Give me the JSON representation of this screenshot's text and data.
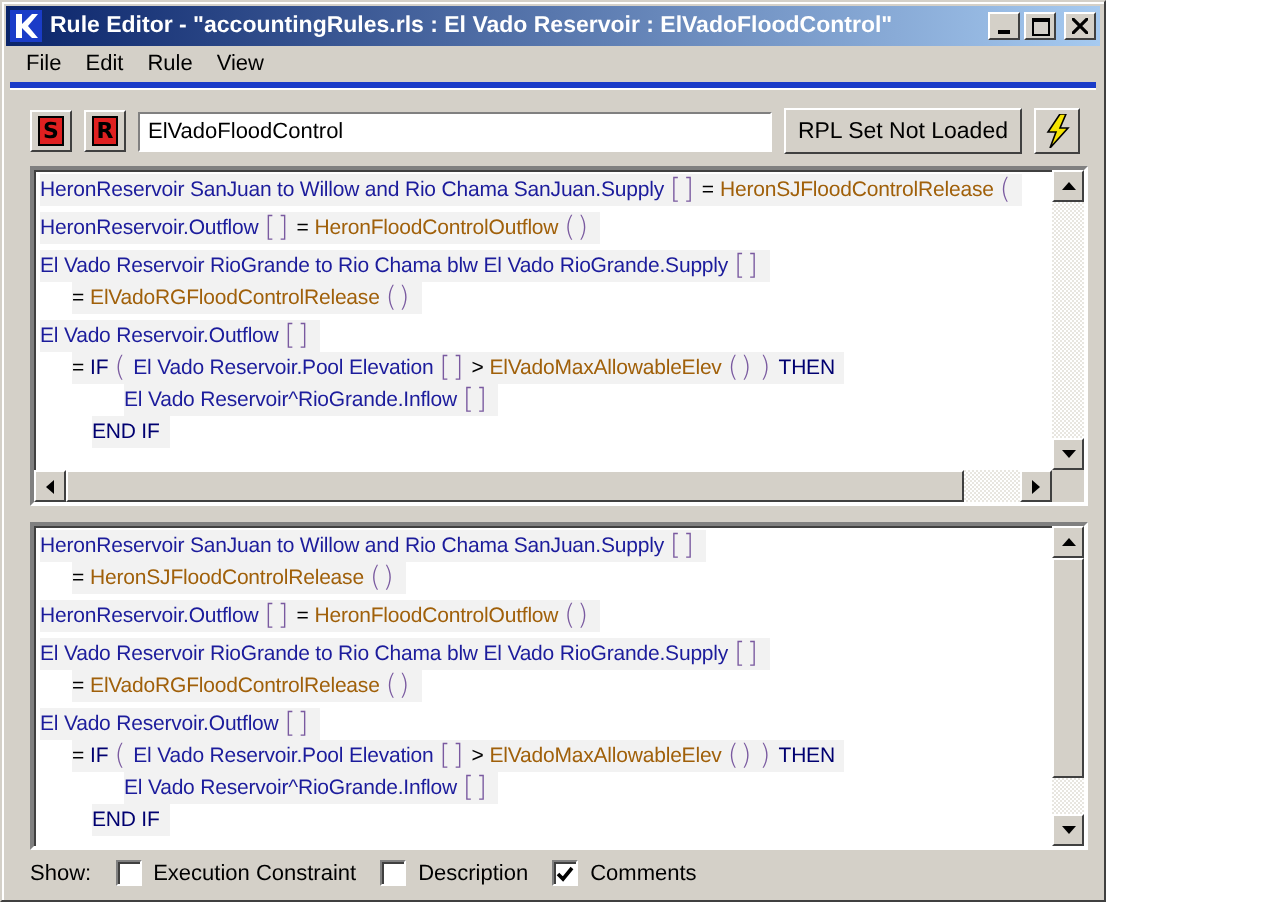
{
  "window": {
    "title": "Rule Editor - \"accountingRules.rls : El Vado Reservoir : ElVadoFloodControl\""
  },
  "menu": [
    "File",
    "Edit",
    "Rule",
    "View"
  ],
  "toolbar": {
    "s_button": "S",
    "r_button": "R",
    "rule_name": "ElVadoFloodControl",
    "status_button": "RPL Set Not Loaded"
  },
  "panes": [
    {
      "statements": [
        {
          "tokens": [
            {
              "kind": "name",
              "text": "HeronReservoir SanJuan to Willow and Rio Chama SanJuan.Supply"
            },
            {
              "kind": "bracket",
              "text": "[]"
            },
            {
              "kind": "op",
              "text": "="
            },
            {
              "kind": "func",
              "text": "HeronSJFloodControlRelease"
            },
            {
              "kind": "bracket",
              "text": "("
            }
          ]
        },
        {
          "tokens": [
            {
              "kind": "name",
              "text": "HeronReservoir.Outflow"
            },
            {
              "kind": "bracket",
              "text": "[]"
            },
            {
              "kind": "op",
              "text": "="
            },
            {
              "kind": "func",
              "text": "HeronFloodControlOutflow"
            },
            {
              "kind": "bracket",
              "text": "()"
            }
          ]
        },
        {
          "tokens": [
            {
              "kind": "name",
              "text": "El Vado Reservoir RioGrande to Rio Chama blw El Vado RioGrande.Supply"
            },
            {
              "kind": "bracket",
              "text": "[]"
            }
          ],
          "children": [
            {
              "tokens": [
                {
                  "kind": "op",
                  "text": "="
                },
                {
                  "kind": "func",
                  "text": "ElVadoRGFloodControlRelease"
                },
                {
                  "kind": "bracket",
                  "text": "()"
                }
              ]
            }
          ]
        },
        {
          "tokens": [
            {
              "kind": "name",
              "text": "El Vado Reservoir.Outflow"
            },
            {
              "kind": "bracket",
              "text": "[]"
            }
          ],
          "children": [
            {
              "tokens": [
                {
                  "kind": "op",
                  "text": "="
                },
                {
                  "kind": "keyword",
                  "text": "IF"
                },
                {
                  "kind": "bracket",
                  "text": "("
                },
                {
                  "kind": "name",
                  "text": "El Vado Reservoir.Pool Elevation"
                },
                {
                  "kind": "bracket",
                  "text": "[]"
                },
                {
                  "kind": "op",
                  "text": ">"
                },
                {
                  "kind": "func",
                  "text": "ElVadoMaxAllowableElev"
                },
                {
                  "kind": "bracket",
                  "text": "()"
                },
                {
                  "kind": "bracket",
                  "text": ")"
                },
                {
                  "kind": "keyword",
                  "text": "THEN"
                }
              ],
              "children": [
                {
                  "tokens": [
                    {
                      "kind": "name",
                      "text": "El Vado Reservoir^RioGrande.Inflow"
                    },
                    {
                      "kind": "bracket",
                      "text": "[]"
                    }
                  ]
                }
              ],
              "end": [
                {
                  "kind": "keyword",
                  "text": "END IF"
                }
              ]
            }
          ]
        }
      ]
    },
    {
      "statements": [
        {
          "tokens": [
            {
              "kind": "name",
              "text": "HeronReservoir SanJuan to Willow and Rio Chama SanJuan.Supply"
            },
            {
              "kind": "bracket",
              "text": "[]"
            }
          ],
          "children": [
            {
              "tokens": [
                {
                  "kind": "op",
                  "text": "="
                },
                {
                  "kind": "func",
                  "text": "HeronSJFloodControlRelease"
                },
                {
                  "kind": "bracket",
                  "text": "()"
                }
              ]
            }
          ]
        },
        {
          "tokens": [
            {
              "kind": "name",
              "text": "HeronReservoir.Outflow"
            },
            {
              "kind": "bracket",
              "text": "[]"
            },
            {
              "kind": "op",
              "text": "="
            },
            {
              "kind": "func",
              "text": "HeronFloodControlOutflow"
            },
            {
              "kind": "bracket",
              "text": "()"
            }
          ]
        },
        {
          "tokens": [
            {
              "kind": "name",
              "text": "El Vado Reservoir RioGrande to Rio Chama blw El Vado RioGrande.Supply"
            },
            {
              "kind": "bracket",
              "text": "[]"
            }
          ],
          "children": [
            {
              "tokens": [
                {
                  "kind": "op",
                  "text": "="
                },
                {
                  "kind": "func",
                  "text": "ElVadoRGFloodControlRelease"
                },
                {
                  "kind": "bracket",
                  "text": "()"
                }
              ]
            }
          ]
        },
        {
          "tokens": [
            {
              "kind": "name",
              "text": "El Vado Reservoir.Outflow"
            },
            {
              "kind": "bracket",
              "text": "[]"
            }
          ],
          "children": [
            {
              "tokens": [
                {
                  "kind": "op",
                  "text": "="
                },
                {
                  "kind": "keyword",
                  "text": "IF"
                },
                {
                  "kind": "bracket",
                  "text": "("
                },
                {
                  "kind": "name",
                  "text": "El Vado Reservoir.Pool Elevation"
                },
                {
                  "kind": "bracket",
                  "text": "[]"
                },
                {
                  "kind": "op",
                  "text": ">"
                },
                {
                  "kind": "func",
                  "text": "ElVadoMaxAllowableElev"
                },
                {
                  "kind": "bracket",
                  "text": "()"
                },
                {
                  "kind": "bracket",
                  "text": ")"
                },
                {
                  "kind": "keyword",
                  "text": "THEN"
                }
              ],
              "children": [
                {
                  "tokens": [
                    {
                      "kind": "name",
                      "text": "El Vado Reservoir^RioGrande.Inflow"
                    },
                    {
                      "kind": "bracket",
                      "text": "[]"
                    }
                  ]
                }
              ],
              "end": [
                {
                  "kind": "keyword",
                  "text": "END IF"
                }
              ]
            }
          ]
        }
      ]
    }
  ],
  "show": {
    "label": "Show:",
    "options": [
      {
        "label": "Execution Constraint",
        "checked": false
      },
      {
        "label": "Description",
        "checked": false
      },
      {
        "label": "Comments",
        "checked": true
      }
    ]
  }
}
